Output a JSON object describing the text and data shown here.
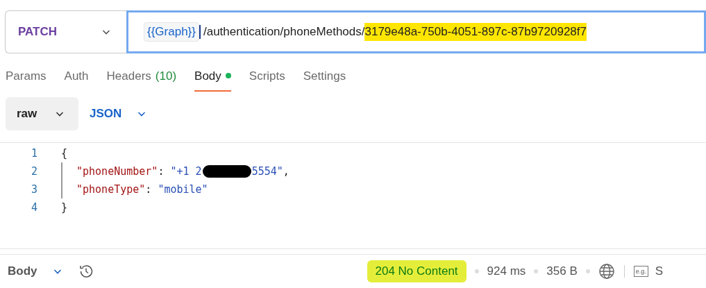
{
  "request": {
    "method": "PATCH",
    "url_variable": "{{Graph}}",
    "url_path": "/authentication/phoneMethods/",
    "url_id": "3179e48a-750b-4051-897c-87b9720928f7",
    "url_id_highlighted": true,
    "focused": true
  },
  "tabs": [
    {
      "label": "Params",
      "selected": false
    },
    {
      "label": "Auth",
      "selected": false
    },
    {
      "label": "Headers",
      "count": "(10)",
      "selected": false
    },
    {
      "label": "Body",
      "dot": true,
      "selected": true
    },
    {
      "label": "Scripts",
      "selected": false
    },
    {
      "label": "Settings",
      "selected": false
    }
  ],
  "body_mode": {
    "mode": "raw",
    "language": "JSON"
  },
  "code_lines": [
    {
      "number": "1",
      "tokens": [
        {
          "kind": "punct",
          "text": "{"
        }
      ],
      "indented": false
    },
    {
      "number": "2",
      "tokens": [
        {
          "kind": "key",
          "text": "\"phoneNumber\""
        },
        {
          "kind": "punct",
          "text": ": "
        },
        {
          "kind": "string",
          "text": "\"+1 2"
        },
        {
          "kind": "redacted"
        },
        {
          "kind": "string",
          "text": "5554\""
        },
        {
          "kind": "punct",
          "text": ","
        }
      ],
      "indented": true
    },
    {
      "number": "3",
      "tokens": [
        {
          "kind": "key",
          "text": "\"phoneType\""
        },
        {
          "kind": "punct",
          "text": ": "
        },
        {
          "kind": "string",
          "text": "\"mobile\""
        }
      ],
      "indented": true
    },
    {
      "number": "4",
      "tokens": [
        {
          "kind": "punct",
          "text": "}"
        }
      ],
      "indented": false
    }
  ],
  "response_bar": {
    "label": "Body",
    "status": "204 No Content",
    "status_highlighted": true,
    "time": "924 ms",
    "size": "356 B",
    "example_label": "e.g.",
    "cut_text": "S"
  }
}
